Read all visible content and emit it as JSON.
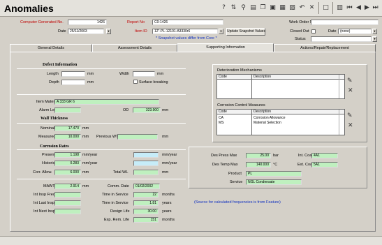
{
  "window": {
    "title": "Anomalies"
  },
  "toolbar": {
    "icons": [
      "help-icon",
      "sort-icon",
      "filter-icon",
      "print-icon",
      "copy-icon",
      "paste-icon",
      "report-icon",
      "attach-icon",
      "undo-icon",
      "close-icon",
      "new-icon",
      "save-icon",
      "first-icon",
      "previous-icon",
      "next-icon",
      "last-icon",
      "exit-icon"
    ]
  },
  "header": {
    "computer_no_label": "Computer Generated No.",
    "computer_no_value": "1426",
    "date_label": "Date",
    "date_value": "25/11/2003",
    "report_no_label": "Report No",
    "report_no_value": "C0-1426",
    "item_id_label": "Item ID",
    "item_id_value": "12\"-PL-12101-A3330r6",
    "snapshot_button": "Update Snapshot Values",
    "snapshot_note": "* Snapshot values differ from Core *",
    "work_order_label": "Work Order No",
    "work_order_value": "",
    "closed_out_label": "Closed Out",
    "closed_date_label": "Date",
    "closed_date_value": "(none)",
    "status_label": "Status",
    "status_value": ""
  },
  "tabs": [
    "General Details",
    "Assessment Details",
    "Supporting Information",
    "Actions/Repair/Replacement"
  ],
  "selected_tab": 2,
  "defect": {
    "heading": "Defect Information",
    "length_label": "Length",
    "length_value": "",
    "length_unit": "mm",
    "depth_label": "Depth",
    "depth_value": "",
    "depth_unit": "mm",
    "width_label": "Width",
    "width_value": "",
    "width_unit": "mm",
    "surface_breaking_label": "Surface breaking"
  },
  "material": {
    "item_material_label": "Item Material",
    "item_material_value": "A 333 GR 6",
    "alarm_level_label": "Alarm Level",
    "alarm_level_value": "",
    "od_label": "OD",
    "od_value": "323.900",
    "od_unit": "mm"
  },
  "wall": {
    "heading": "Wall Thickness",
    "nominal_label": "Nominal",
    "nominal_value": "17.470",
    "nominal_unit": "mm",
    "measured_label": "Measured",
    "measured_value": "10.000",
    "measured_unit": "mm",
    "previous_wt_label": "Previous WT",
    "previous_wt_value": "",
    "previous_wt_unit": "mm"
  },
  "corrosion": {
    "heading": "Corrosion Rates",
    "present_label": "Present",
    "present_value": "1.198",
    "present_unit": "mm/year",
    "present_right_value": "",
    "present_right_unit": "mm/year",
    "historic_label": "Historic",
    "historic_value": "0.283",
    "historic_unit": "mm/year",
    "historic_right_value": "",
    "historic_right_unit": "mm/year",
    "allow_label": "Corr. Allow.",
    "allow_value": "6.000",
    "allow_unit": "mm",
    "total_wl_label": "Total WL",
    "total_wl_value": "",
    "total_wl_unit": "mm"
  },
  "inspection": {
    "mawt_label": "MAWT",
    "mawt_value": "2.914",
    "mawt_unit": "mm",
    "comm_date_label": "Comm. Date",
    "comm_date_value": "01/02/2002",
    "freq_label": "Int Insp Freq",
    "freq_value": "",
    "time_in_service_label": "Time in Service",
    "time_in_service_value": "22",
    "time_in_service_unit": "months",
    "last_insp_label": "Int Last Insp",
    "last_insp_value": "",
    "time_in_service2_label": "Time in Service",
    "time_in_service2_value": "1.81",
    "time_in_service2_unit": "years",
    "next_insp_label": "Int Next Insp",
    "next_insp_value": "",
    "design_life_label": "Design Life",
    "design_life_value": "30.00",
    "design_life_unit": "years",
    "rem_life_label": "Exp. Rem. Life",
    "rem_life_value": "151",
    "rem_life_unit": "months"
  },
  "deterioration": {
    "title": "Deterioration Mechanisms",
    "col_code": "Code",
    "col_desc": "Description",
    "rows": []
  },
  "corrosion_control": {
    "title": "Corrosion Control Measures",
    "col_code": "Code",
    "col_desc": "Description",
    "rows": [
      {
        "code": "CA",
        "desc": "Corrosion Allowance"
      },
      {
        "code": "MS",
        "desc": "Material Selection"
      }
    ]
  },
  "design": {
    "press_label": "Des Press Max",
    "press_value": "25.00",
    "press_unit": "bar",
    "temp_label": "Des Temp Max",
    "temp_value": "140.000",
    "temp_unit": "°C",
    "product_label": "Product",
    "product_value": "PL",
    "service_label": "Service",
    "service_value": "NGL Condensate",
    "int_coat_label": "Int. Coat",
    "int_coat_value": "4A1",
    "ext_coat_label": "Ext. Coat",
    "ext_coat_value": "5A1"
  },
  "note": "(Source for calculated frequencies is from Feature)"
}
